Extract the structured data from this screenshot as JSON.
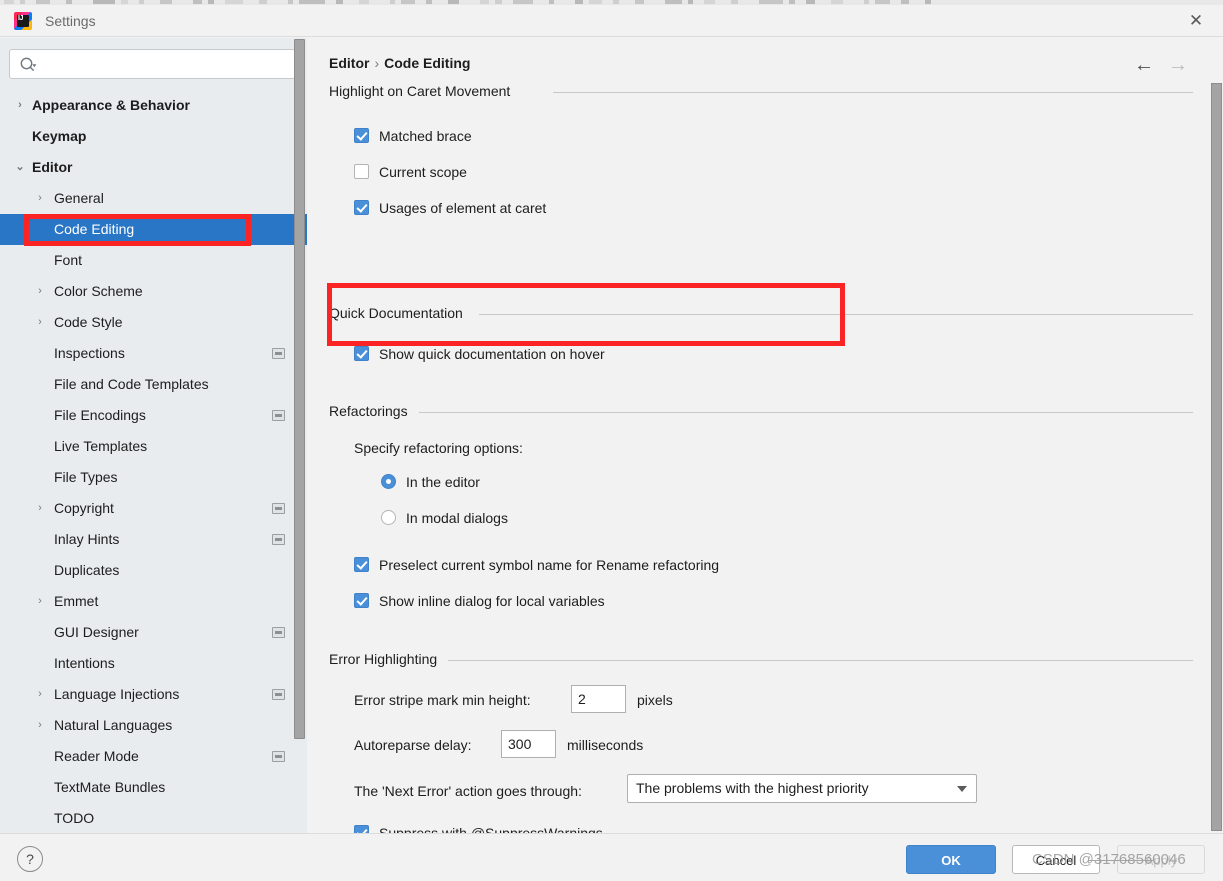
{
  "window": {
    "title": "Settings",
    "logo_icon": "intellij-idea-logo-icon",
    "close_icon": "close-icon"
  },
  "search": {
    "value": "",
    "placeholder": "",
    "icon": "search-icon"
  },
  "sidebar": {
    "items": [
      {
        "label": "Appearance & Behavior",
        "level": 0,
        "bold": true,
        "arrow": "›",
        "badge": false,
        "selected": false
      },
      {
        "label": "Keymap",
        "level": 0,
        "bold": true,
        "arrow": "",
        "badge": false,
        "selected": false
      },
      {
        "label": "Editor",
        "level": 0,
        "bold": true,
        "arrow": "⌄",
        "badge": false,
        "selected": false
      },
      {
        "label": "General",
        "level": 1,
        "bold": false,
        "arrow": "›",
        "badge": false,
        "selected": false
      },
      {
        "label": "Code Editing",
        "level": 1,
        "bold": false,
        "arrow": "",
        "badge": false,
        "selected": true
      },
      {
        "label": "Font",
        "level": 1,
        "bold": false,
        "arrow": "",
        "badge": false,
        "selected": false
      },
      {
        "label": "Color Scheme",
        "level": 1,
        "bold": false,
        "arrow": "›",
        "badge": false,
        "selected": false
      },
      {
        "label": "Code Style",
        "level": 1,
        "bold": false,
        "arrow": "›",
        "badge": false,
        "selected": false
      },
      {
        "label": "Inspections",
        "level": 1,
        "bold": false,
        "arrow": "",
        "badge": true,
        "selected": false
      },
      {
        "label": "File and Code Templates",
        "level": 1,
        "bold": false,
        "arrow": "",
        "badge": false,
        "selected": false
      },
      {
        "label": "File Encodings",
        "level": 1,
        "bold": false,
        "arrow": "",
        "badge": true,
        "selected": false
      },
      {
        "label": "Live Templates",
        "level": 1,
        "bold": false,
        "arrow": "",
        "badge": false,
        "selected": false
      },
      {
        "label": "File Types",
        "level": 1,
        "bold": false,
        "arrow": "",
        "badge": false,
        "selected": false
      },
      {
        "label": "Copyright",
        "level": 1,
        "bold": false,
        "arrow": "›",
        "badge": true,
        "selected": false
      },
      {
        "label": "Inlay Hints",
        "level": 1,
        "bold": false,
        "arrow": "",
        "badge": true,
        "selected": false
      },
      {
        "label": "Duplicates",
        "level": 1,
        "bold": false,
        "arrow": "",
        "badge": false,
        "selected": false
      },
      {
        "label": "Emmet",
        "level": 1,
        "bold": false,
        "arrow": "›",
        "badge": false,
        "selected": false
      },
      {
        "label": "GUI Designer",
        "level": 1,
        "bold": false,
        "arrow": "",
        "badge": true,
        "selected": false
      },
      {
        "label": "Intentions",
        "level": 1,
        "bold": false,
        "arrow": "",
        "badge": false,
        "selected": false
      },
      {
        "label": "Language Injections",
        "level": 1,
        "bold": false,
        "arrow": "›",
        "badge": true,
        "selected": false
      },
      {
        "label": "Natural Languages",
        "level": 1,
        "bold": false,
        "arrow": "›",
        "badge": false,
        "selected": false
      },
      {
        "label": "Reader Mode",
        "level": 1,
        "bold": false,
        "arrow": "",
        "badge": true,
        "selected": false
      },
      {
        "label": "TextMate Bundles",
        "level": 1,
        "bold": false,
        "arrow": "",
        "badge": false,
        "selected": false
      },
      {
        "label": "TODO",
        "level": 1,
        "bold": false,
        "arrow": "",
        "badge": false,
        "selected": false
      }
    ]
  },
  "main": {
    "breadcrumb": {
      "parent": "Editor",
      "separator": "›",
      "current": "Code Editing"
    },
    "nav": {
      "back_icon": "arrow-left-icon",
      "forward_icon": "arrow-right-icon"
    },
    "sections": {
      "caret": {
        "title": "Highlight on Caret Movement",
        "options": [
          {
            "label": "Matched brace",
            "checked": true
          },
          {
            "label": "Current scope",
            "checked": false
          },
          {
            "label": "Usages of element at caret",
            "checked": true
          }
        ]
      },
      "quick_doc": {
        "title": "Quick Documentation",
        "options": [
          {
            "label": "Show quick documentation on hover",
            "checked": true
          }
        ]
      },
      "refactorings": {
        "title": "Refactorings",
        "specify_label": "Specify refactoring options:",
        "radios": [
          {
            "label": "In the editor",
            "selected": true
          },
          {
            "label": "In modal dialogs",
            "selected": false
          }
        ],
        "options": [
          {
            "label": "Preselect current symbol name for Rename refactoring",
            "checked": true
          },
          {
            "label": "Show inline dialog for local variables",
            "checked": true
          }
        ]
      },
      "error_highlighting": {
        "title": "Error Highlighting",
        "stripe_label": "Error stripe mark min height:",
        "stripe_value": "2",
        "stripe_unit": "pixels",
        "autoreparse_label": "Autoreparse delay:",
        "autoreparse_value": "300",
        "autoreparse_unit": "milliseconds",
        "next_error_label": "The 'Next Error' action goes through:",
        "next_error_value": "The problems with the highest priority",
        "suppress": {
          "label": "Suppress with @SuppressWarnings",
          "checked": true
        }
      }
    }
  },
  "footer": {
    "help_label": "?",
    "ok_label": "OK",
    "cancel_label": "Cancel",
    "apply_label": "Apply"
  },
  "watermark": {
    "text": "CSDN @31768560046"
  },
  "colors": {
    "accent_blue": "#4a90d9",
    "selection_blue": "#2a76c6",
    "annotation_red": "#fb2424",
    "sidebar_bg": "#e8ecef",
    "panel_bg": "#f2f2f2"
  }
}
